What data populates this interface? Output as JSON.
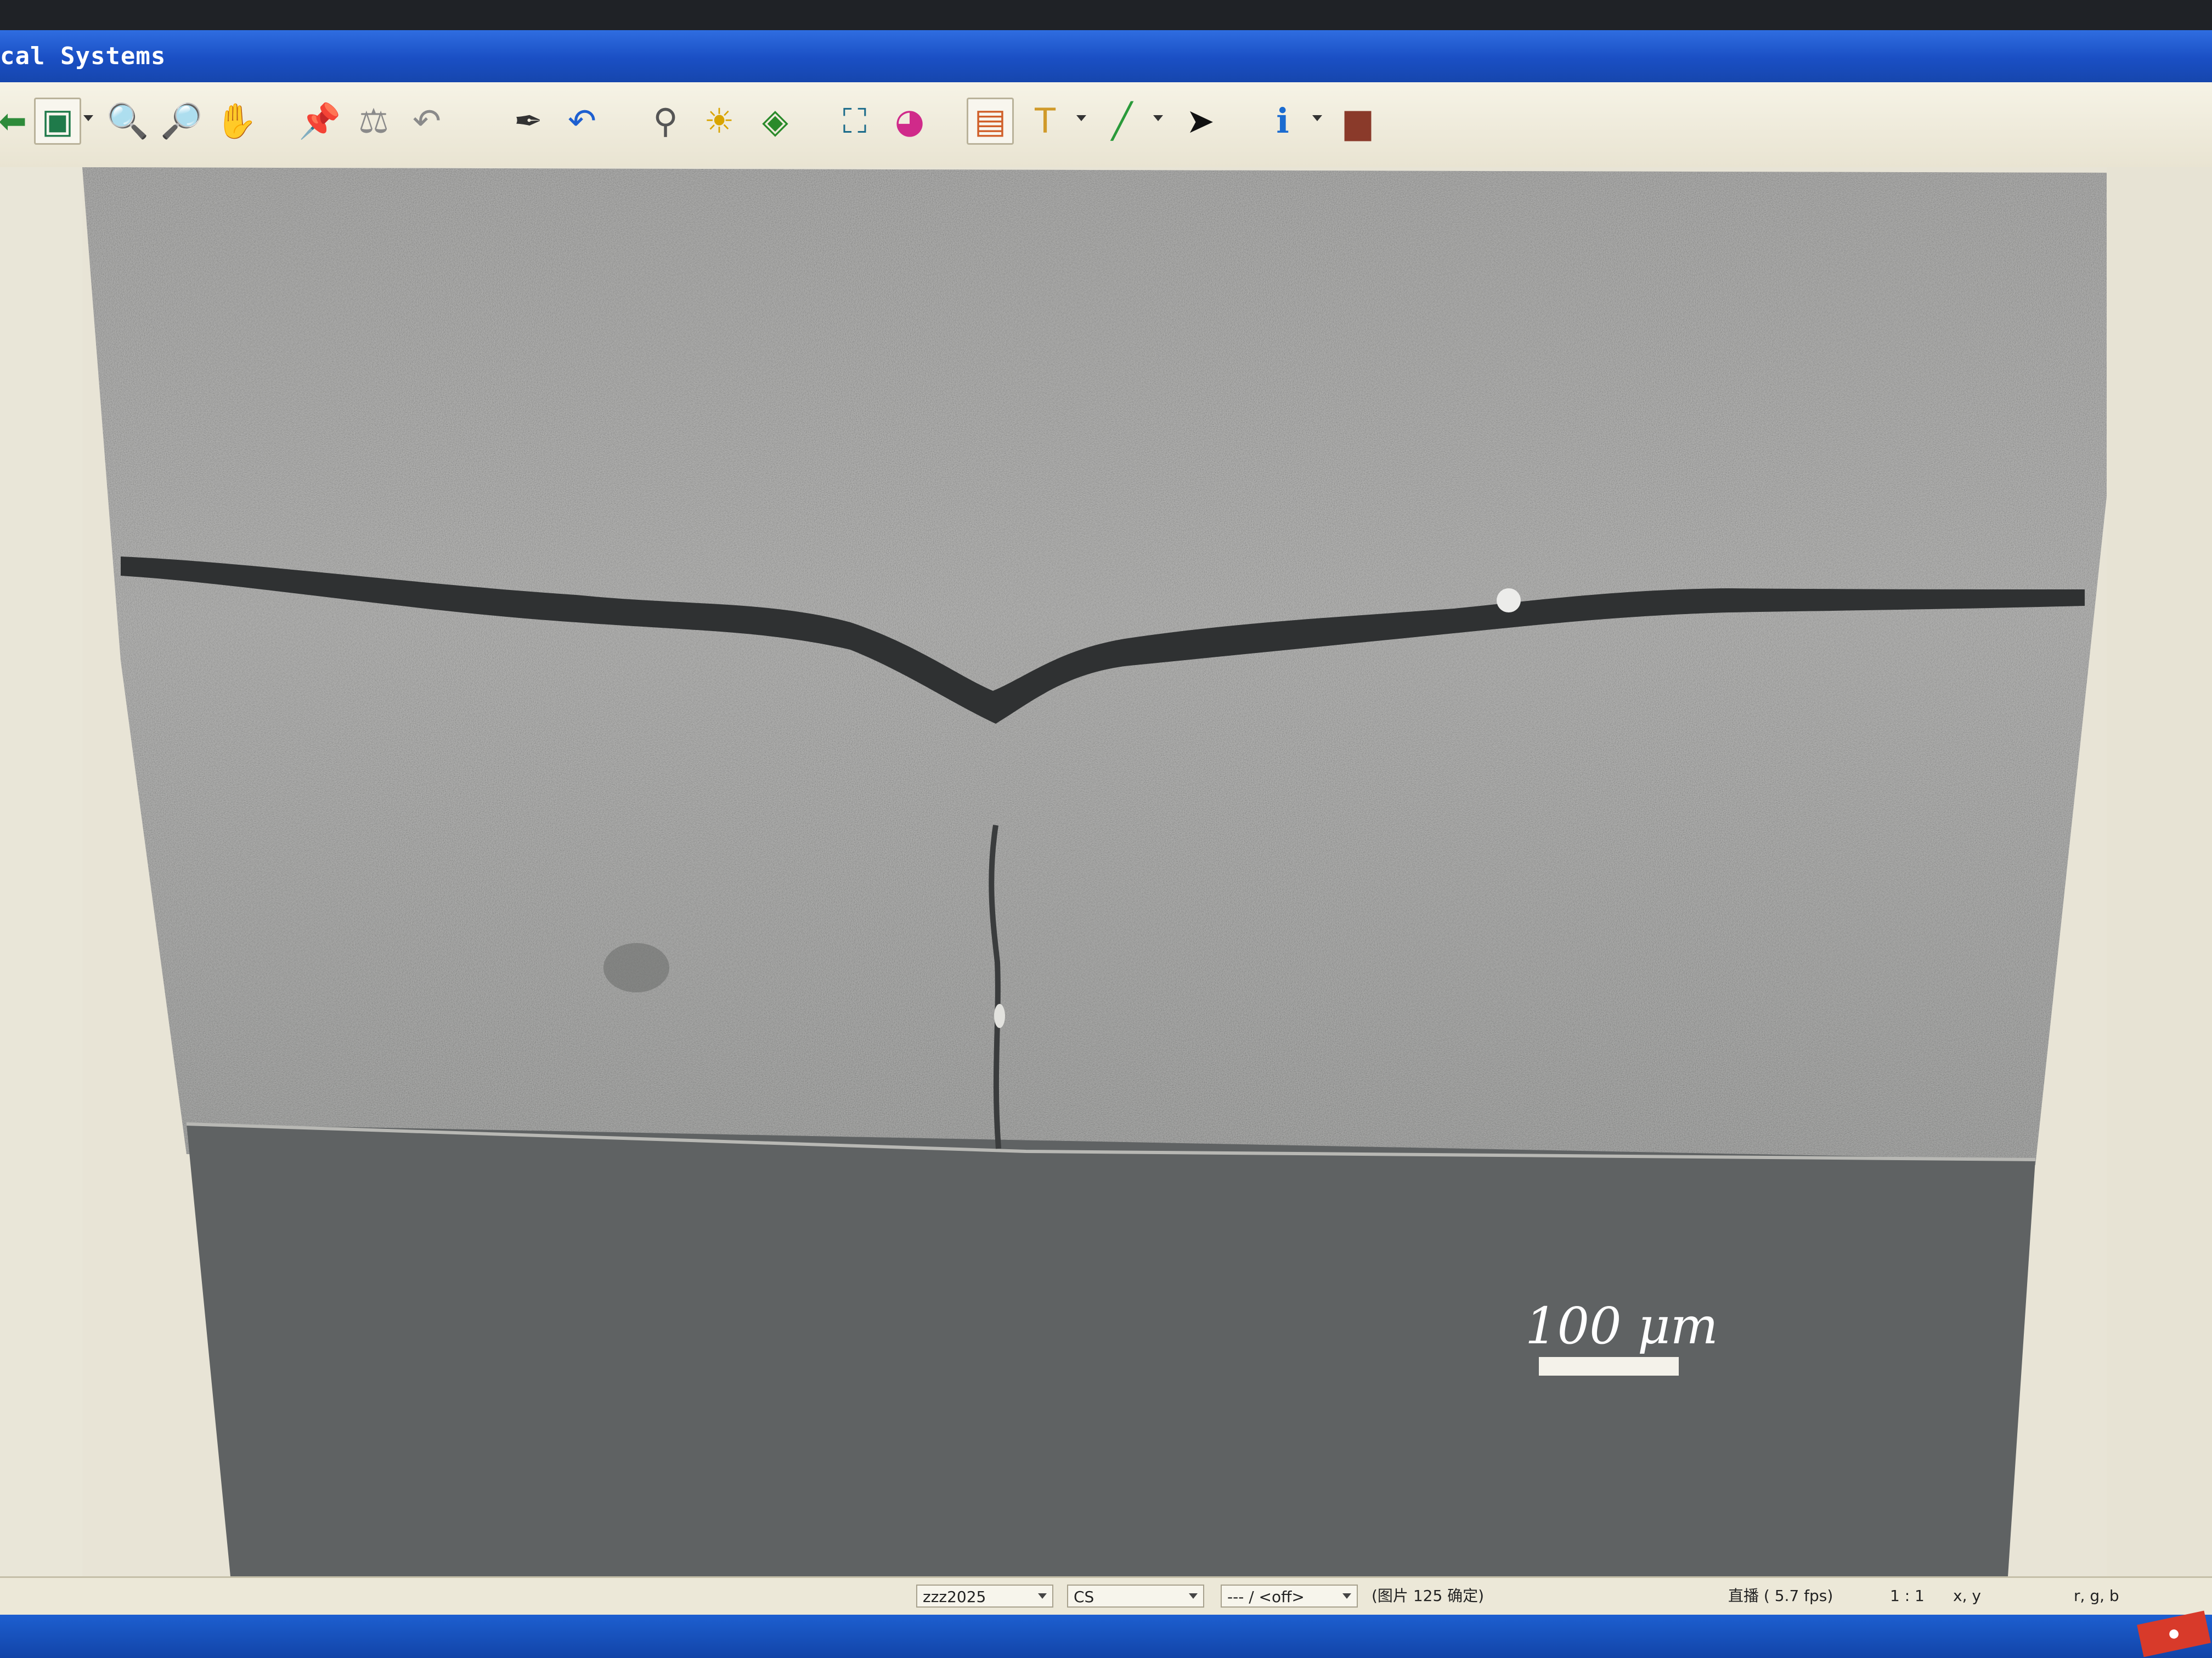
{
  "window": {
    "title": "cal Systems"
  },
  "toolbar": {
    "buttons": [
      {
        "name": "back-arrow-icon",
        "glyph": "⬅",
        "color": "#2e8b3a"
      },
      {
        "name": "live-view-icon",
        "glyph": "▣",
        "color": "#1f7a4a"
      },
      {
        "name": "zoom-in-icon",
        "glyph": "🔍",
        "color": "#2a2a2a"
      },
      {
        "name": "zoom-out-icon",
        "glyph": "🔎",
        "color": "#2a2a2a"
      },
      {
        "name": "hand-pan-icon",
        "glyph": "✋",
        "color": "#e08a2a"
      },
      {
        "name": "pin-icon",
        "glyph": "📌",
        "color": "#8a8a8a"
      },
      {
        "name": "measure-icon",
        "glyph": "⚖",
        "color": "#8a8a8a"
      },
      {
        "name": "undo-gray-icon",
        "glyph": "↶",
        "color": "#8a8a8a"
      },
      {
        "name": "eyedropper-icon",
        "glyph": "✒",
        "color": "#333333"
      },
      {
        "name": "undo-icon",
        "glyph": "↶",
        "color": "#1d5fd0"
      },
      {
        "name": "magnifier-icon",
        "glyph": "⚲",
        "color": "#555555"
      },
      {
        "name": "brightness-icon",
        "glyph": "☀",
        "color": "#d9a400"
      },
      {
        "name": "layers-icon",
        "glyph": "◈",
        "color": "#2a8a2a"
      },
      {
        "name": "crop-icon",
        "glyph": "⛶",
        "color": "#1a6b8a"
      },
      {
        "name": "color-wheel-icon",
        "glyph": "◕",
        "color": "#d02a8a"
      },
      {
        "name": "overlay-icon",
        "glyph": "▤",
        "color": "#d0602a"
      },
      {
        "name": "text-icon",
        "glyph": "T",
        "color": "#d09a2a"
      },
      {
        "name": "line-tool-icon",
        "glyph": "╱",
        "color": "#2a9a3a"
      },
      {
        "name": "pointer-icon",
        "glyph": "➤",
        "color": "#111111"
      },
      {
        "name": "info-icon",
        "glyph": "ℹ",
        "color": "#1a6bd0"
      },
      {
        "name": "toolbox-icon",
        "glyph": "▆",
        "color": "#8a3a2a"
      }
    ]
  },
  "image": {
    "scale_label": "100 μm"
  },
  "statusbar": {
    "camera": "zzz2025",
    "mode": "CS",
    "overlay": "--- / <off>",
    "image_info": "(图片 125 确定)",
    "live": "直播 ( 5.7 fps)",
    "zoom": "1 : 1",
    "coords_label": "x, y",
    "rgb_label": "r, g, b"
  }
}
